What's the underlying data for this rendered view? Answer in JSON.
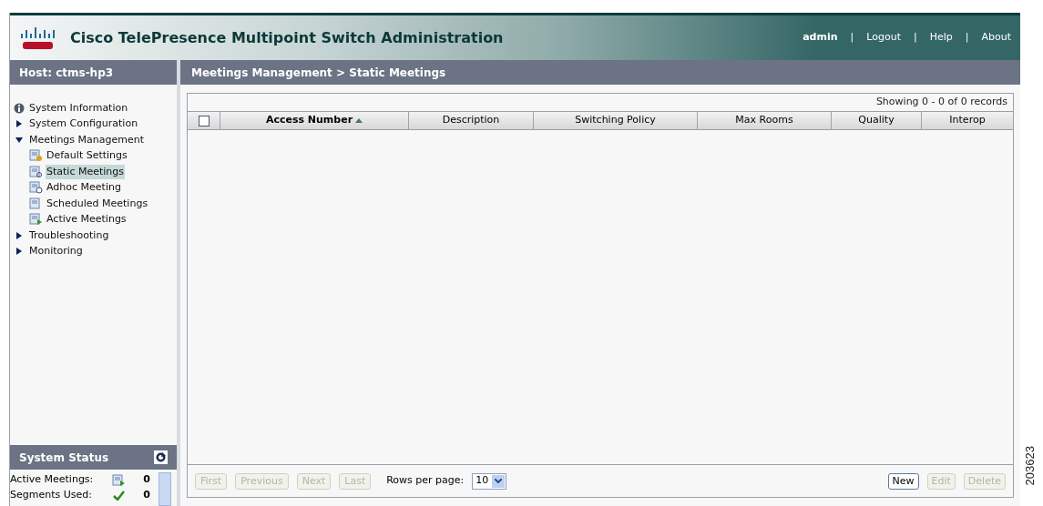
{
  "header": {
    "title": "Cisco TelePresence Multipoint Switch Administration",
    "user": "admin",
    "links": [
      "Logout",
      "Help",
      "About"
    ],
    "separator": "|"
  },
  "host": "Host: ctms-hp3",
  "breadcrumb": "Meetings Management > Static Meetings",
  "nav": [
    {
      "label": "System Information",
      "kind": "info"
    },
    {
      "label": "System Configuration",
      "kind": "group",
      "expanded": false
    },
    {
      "label": "Meetings Management",
      "kind": "group",
      "expanded": true,
      "children": [
        {
          "label": "Default Settings",
          "selected": false
        },
        {
          "label": "Static Meetings",
          "selected": true
        },
        {
          "label": "Adhoc Meeting",
          "selected": false
        },
        {
          "label": "Scheduled Meetings",
          "selected": false
        },
        {
          "label": "Active Meetings",
          "selected": false
        }
      ]
    },
    {
      "label": "Troubleshooting",
      "kind": "group",
      "expanded": false
    },
    {
      "label": "Monitoring",
      "kind": "group",
      "expanded": false
    }
  ],
  "system_status": {
    "title": "System Status",
    "rows": [
      {
        "label": "Active Meetings:",
        "kind": "meetings",
        "value": "0"
      },
      {
        "label": "Segments Used:",
        "kind": "ok",
        "value": "0"
      }
    ]
  },
  "table": {
    "records": "Showing 0 - 0 of 0 records",
    "select_all_checked": false,
    "columns": [
      {
        "label": "Access Number",
        "sorted": true
      },
      {
        "label": "Description",
        "sorted": false
      },
      {
        "label": "Switching Policy",
        "sorted": false
      },
      {
        "label": "Max Rooms",
        "sorted": false
      },
      {
        "label": "Quality",
        "sorted": false
      },
      {
        "label": "Interop",
        "sorted": false
      }
    ]
  },
  "pagination": [
    {
      "label": "First",
      "disabled": true
    },
    {
      "label": "Previous",
      "disabled": true
    },
    {
      "label": "Next",
      "disabled": true
    },
    {
      "label": "Last",
      "disabled": true
    }
  ],
  "rows_per_page": {
    "label": "Rows per page:",
    "value": "10"
  },
  "actions": [
    {
      "label": "New",
      "disabled": false
    },
    {
      "label": "Edit",
      "disabled": true
    },
    {
      "label": "Delete",
      "disabled": true
    }
  ],
  "figure_number": "203623"
}
